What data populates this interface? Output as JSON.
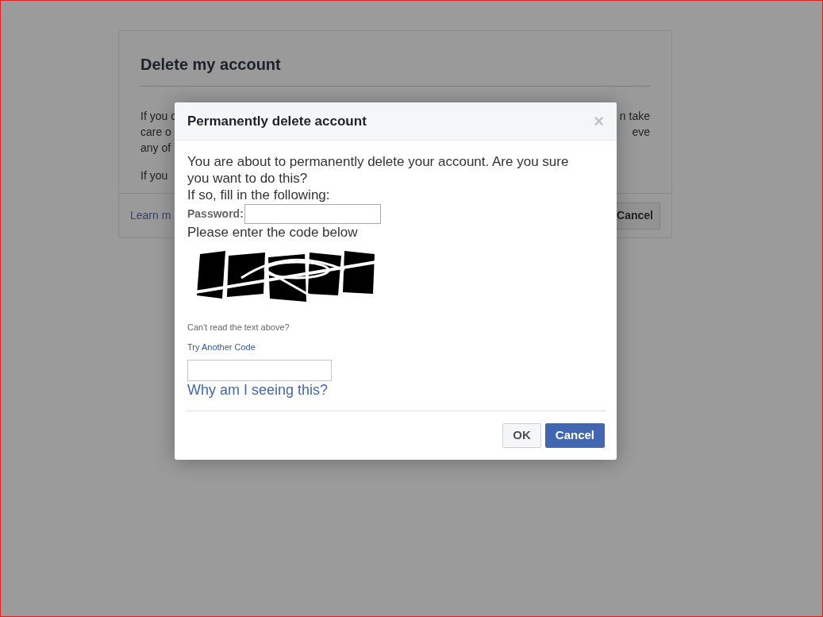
{
  "background_card": {
    "title": "Delete my account",
    "body_lines": [
      {
        "left": "If you c",
        "right": "n take"
      },
      {
        "left": "care o",
        "right": "eve"
      },
      {
        "left": "any of"
      }
    ],
    "last_line": "If you",
    "footer_link": "Learn m",
    "footer_button": "Cancel"
  },
  "dialog": {
    "title": "Permanently delete account",
    "close": "×",
    "message": "You are about to permanently delete your account. Are you sure you want to do this?",
    "instruction": "If so, fill in the following:",
    "password_label": "Password:",
    "code_prompt": "Please enter the code below",
    "cant_read": "Can't read the text above?",
    "try_another": "Try Another Code",
    "why_link": "Why am I seeing this?",
    "buttons": [
      {
        "label": "OK",
        "kind": "secondary"
      },
      {
        "label": "Cancel",
        "kind": "primary"
      }
    ]
  }
}
